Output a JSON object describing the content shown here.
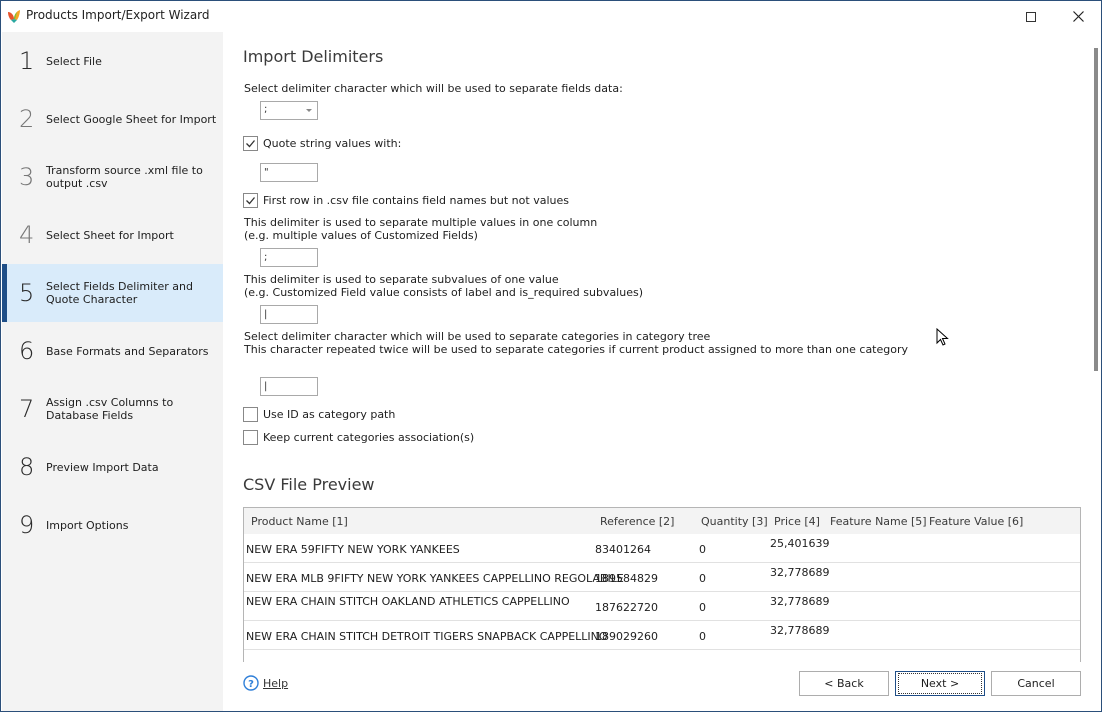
{
  "window": {
    "title": "Products Import/Export Wizard",
    "maximize_icon": "maximize-icon",
    "close_icon": "close-icon"
  },
  "sidebar": {
    "active_step": 5,
    "steps": [
      {
        "num": "1",
        "label": "Select File"
      },
      {
        "num": "2",
        "label": "Select Google Sheet for Import"
      },
      {
        "num": "3",
        "label": "Transform source .xml file to output .csv"
      },
      {
        "num": "4",
        "label": "Select Sheet for Import"
      },
      {
        "num": "5",
        "label": "Select Fields Delimiter and Quote Character"
      },
      {
        "num": "6",
        "label": "Base Formats and Separators"
      },
      {
        "num": "7",
        "label": "Assign .csv Columns to Database Fields"
      },
      {
        "num": "8",
        "label": "Preview Import Data"
      },
      {
        "num": "9",
        "label": "Import Options"
      }
    ]
  },
  "import_delimiters": {
    "heading": "Import Delimiters",
    "field_delimiter_label": "Select delimiter character which will be used to separate fields data:",
    "field_delimiter_value": ";",
    "quote_checkbox_label": "Quote string values with:",
    "quote_checked": true,
    "quote_value": "\"",
    "first_row_label": "First row in .csv file contains field names but not values",
    "first_row_checked": true,
    "multi_values_label_1": "This delimiter is used to separate multiple values in one column",
    "multi_values_label_2": "(e.g. multiple values of Customized Fields)",
    "multi_values_value": ";",
    "subvalues_label_1": "This delimiter is used to separate subvalues of one value",
    "subvalues_label_2": "(e.g. Customized Field value consists of label and is_required subvalues)",
    "subvalues_value": "|",
    "category_label_1": "Select delimiter character which will be used to separate categories in category tree",
    "category_label_2": "This character repeated twice will be used to separate categories if current product assigned to more than one category",
    "category_value": "|",
    "use_id_label": "Use ID as category path",
    "use_id_checked": false,
    "keep_categories_label": "Keep current categories association(s)",
    "keep_categories_checked": false
  },
  "csv_preview": {
    "heading": "CSV File Preview",
    "columns": [
      "Product Name [1]",
      "Reference [2]",
      "Quantity [3]",
      "Price [4]",
      "Feature Name [5]",
      "Feature Value [6]"
    ],
    "rows": [
      [
        "NEW ERA 59FIFTY NEW YORK YANKEES",
        "83401264",
        "0",
        "25,401639",
        "",
        ""
      ],
      [
        "NEW ERA MLB 9FIFTY NEW YORK YANKEES CAPPELLINO REGOLABILE",
        "189584829",
        "0",
        "32,778689",
        "",
        ""
      ],
      [
        "NEW ERA CHAIN STITCH OAKLAND ATHLETICS CAPPELLINO",
        "187622720",
        "0",
        "32,778689",
        "",
        ""
      ],
      [
        "NEW ERA CHAIN STITCH DETROIT TIGERS SNAPBACK CAPPELLINO",
        "189029260",
        "0",
        "32,778689",
        "",
        ""
      ]
    ]
  },
  "footer": {
    "help_label": "Help",
    "back_label": "< Back",
    "next_label": "Next >",
    "cancel_label": "Cancel"
  },
  "colors": {
    "accent": "#1f4e87",
    "active_step_bg": "#d9ebfa",
    "sidebar_bg": "#f3f3f3",
    "help_icon": "#2f7fd8"
  }
}
